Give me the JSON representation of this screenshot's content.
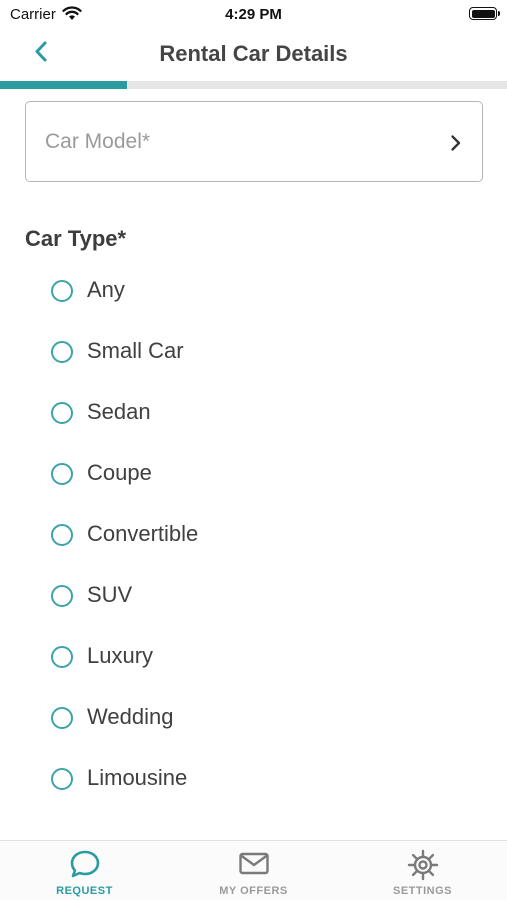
{
  "status_bar": {
    "carrier": "Carrier",
    "time": "4:29 PM"
  },
  "nav": {
    "title": "Rental Car Details",
    "back_icon": "chevron-left-icon"
  },
  "progress": {
    "fraction": 0.25,
    "color": "#2a9ba0"
  },
  "car_model": {
    "placeholder": "Car Model*",
    "value": "",
    "icon": "chevron-right-icon"
  },
  "car_type": {
    "label": "Car Type*",
    "selected": null,
    "options": [
      {
        "label": "Any"
      },
      {
        "label": "Small Car"
      },
      {
        "label": "Sedan"
      },
      {
        "label": "Coupe"
      },
      {
        "label": "Convertible"
      },
      {
        "label": "SUV"
      },
      {
        "label": "Luxury"
      },
      {
        "label": "Wedding"
      },
      {
        "label": "Limousine"
      }
    ]
  },
  "tabs": [
    {
      "label": "REQUEST",
      "icon": "chat-bubble-icon",
      "active": true
    },
    {
      "label": "MY OFFERS",
      "icon": "envelope-icon",
      "active": false
    },
    {
      "label": "SETTINGS",
      "icon": "gear-icon",
      "active": false
    }
  ],
  "colors": {
    "accent": "#2a9ba0",
    "radio": "#3ca4a8",
    "inactive": "#9a9a9a"
  }
}
